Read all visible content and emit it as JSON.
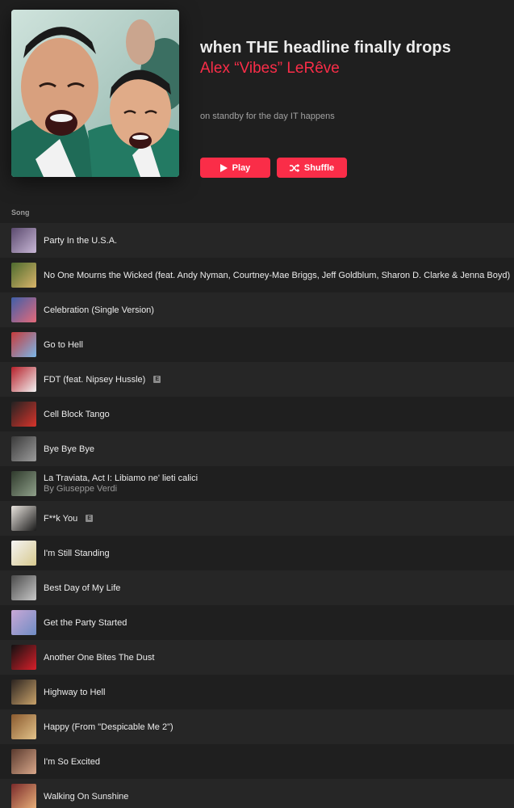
{
  "playlist": {
    "title": "when THE headline finally drops",
    "curator": "Alex “Vibes” LeRêve",
    "description": "on standby for the day IT happens",
    "play_label": "Play",
    "shuffle_label": "Shuffle",
    "cover_icon": "playlist-artwork"
  },
  "list": {
    "column_header": "Song",
    "songs": [
      {
        "title": "Party In the U.S.A.",
        "subtitle": "",
        "explicit": false,
        "thumb": [
          "#5b4a6e",
          "#c8b7d6"
        ]
      },
      {
        "title": "No One Mourns the Wicked (feat. Andy Nyman, Courtney-Mae Briggs, Jeff Goldblum, Sharon D. Clarke & Jenna Boyd)",
        "subtitle": "",
        "explicit": false,
        "thumb": [
          "#4d6b2e",
          "#d9b46a"
        ]
      },
      {
        "title": "Celebration (Single Version)",
        "subtitle": "",
        "explicit": false,
        "thumb": [
          "#3f5fa8",
          "#e56a7a"
        ]
      },
      {
        "title": "Go to Hell",
        "subtitle": "",
        "explicit": false,
        "thumb": [
          "#c63b3b",
          "#7ab6e8"
        ]
      },
      {
        "title": "FDT (feat. Nipsey Hussle)",
        "subtitle": "",
        "explicit": true,
        "thumb": [
          "#b5202a",
          "#f2f2f2"
        ]
      },
      {
        "title": "Cell Block Tango",
        "subtitle": "",
        "explicit": false,
        "thumb": [
          "#222222",
          "#d8342b"
        ]
      },
      {
        "title": "Bye Bye Bye",
        "subtitle": "",
        "explicit": false,
        "thumb": [
          "#3a3a3a",
          "#9c9c9c"
        ]
      },
      {
        "title": "La Traviata, Act I: Libiamo ne' lieti calici",
        "subtitle": "By Giuseppe Verdi",
        "explicit": false,
        "thumb": [
          "#2f3a2c",
          "#8fa08a"
        ]
      },
      {
        "title": "F**k You",
        "subtitle": "",
        "explicit": true,
        "thumb": [
          "#e9e4de",
          "#1a1a1a"
        ]
      },
      {
        "title": "I'm Still Standing",
        "subtitle": "",
        "explicit": false,
        "thumb": [
          "#f4f4f4",
          "#d7c98e"
        ]
      },
      {
        "title": "Best Day of My Life",
        "subtitle": "",
        "explicit": false,
        "thumb": [
          "#4b4b4b",
          "#c9c9c9"
        ]
      },
      {
        "title": "Get the Party Started",
        "subtitle": "",
        "explicit": false,
        "thumb": [
          "#c9a8d6",
          "#6f8cc4"
        ]
      },
      {
        "title": "Another One Bites The Dust",
        "subtitle": "",
        "explicit": false,
        "thumb": [
          "#111111",
          "#d81f2a"
        ]
      },
      {
        "title": "Highway to Hell",
        "subtitle": "",
        "explicit": false,
        "thumb": [
          "#2b2420",
          "#c9a26a"
        ]
      },
      {
        "title": "Happy (From \"Despicable Me 2\")",
        "subtitle": "",
        "explicit": false,
        "thumb": [
          "#8a5a2f",
          "#e3c38a"
        ]
      },
      {
        "title": "I'm So Excited",
        "subtitle": "",
        "explicit": false,
        "thumb": [
          "#5a3a2e",
          "#d8a78a"
        ]
      },
      {
        "title": "Walking On Sunshine",
        "subtitle": "",
        "explicit": false,
        "thumb": [
          "#7a2a2a",
          "#e8b07a"
        ]
      }
    ]
  },
  "colors": {
    "accent": "#fa2d48",
    "background": "#1f1f1f",
    "row_alt": "#262626"
  }
}
